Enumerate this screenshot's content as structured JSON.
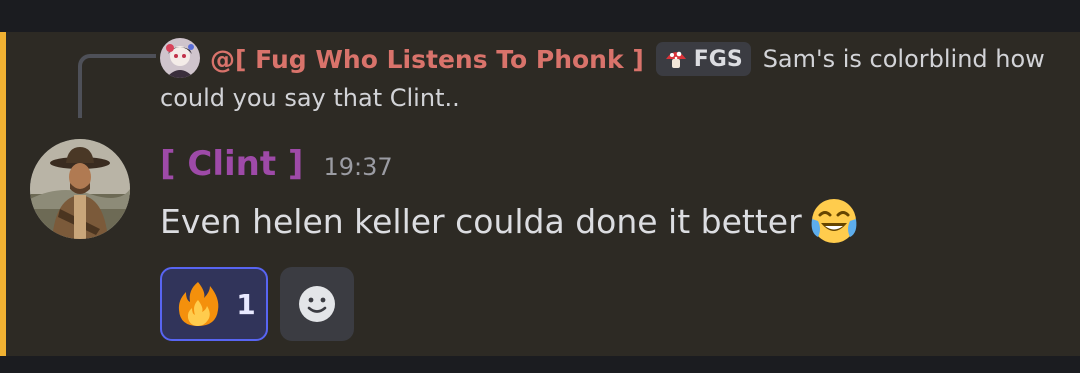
{
  "reply": {
    "author": "@[ Fug Who Listens To Phonk ]",
    "role_badge": "FGS",
    "text_line1": "Sam's is colorblind how",
    "text_line2": "could you say that Clint..",
    "avatar_icon": "anime-avatar-icon",
    "role_icon": "mushroom-icon"
  },
  "message": {
    "author": "[ Clint ]",
    "timestamp": "19:37",
    "content": "Even helen keller coulda done it better",
    "content_emoji": "joy-emoji-icon",
    "author_color": "#9e4aa8",
    "highlight_color": "#f0b132"
  },
  "reactions": [
    {
      "emoji": "fire-emoji-icon",
      "count": "1",
      "selected": true
    }
  ],
  "add_reaction": {
    "icon": "smiley-add-reaction-icon"
  }
}
